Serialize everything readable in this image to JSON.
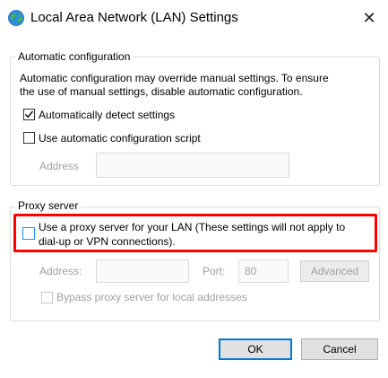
{
  "window": {
    "title": "Local Area Network (LAN) Settings",
    "close_glyph": "✕"
  },
  "auto_config": {
    "group_label": "Automatic configuration",
    "description_line1": "Automatic configuration may override manual settings.  To ensure",
    "description_line2": "the use of manual settings, disable automatic configuration.",
    "detect_settings": {
      "label": "Automatically detect settings",
      "checked": true
    },
    "use_script": {
      "label": "Use automatic configuration script",
      "checked": false
    },
    "address_label": "Address",
    "address_value": ""
  },
  "proxy": {
    "group_label": "Proxy server",
    "use_proxy_line1": "Use a proxy server for your LAN (These settings will not apply to",
    "use_proxy_line2": "dial-up or VPN connections).",
    "use_proxy_checked": false,
    "address_label": "Address:",
    "address_value": "",
    "port_label": "Port:",
    "port_value": "80",
    "advanced_label": "Advanced",
    "bypass_label": "Bypass proxy server for local addresses",
    "bypass_checked": false
  },
  "buttons": {
    "ok_label": "OK",
    "cancel_label": "Cancel"
  },
  "colors": {
    "highlight": "#ff0000",
    "focus_blue": "#0078d7"
  }
}
